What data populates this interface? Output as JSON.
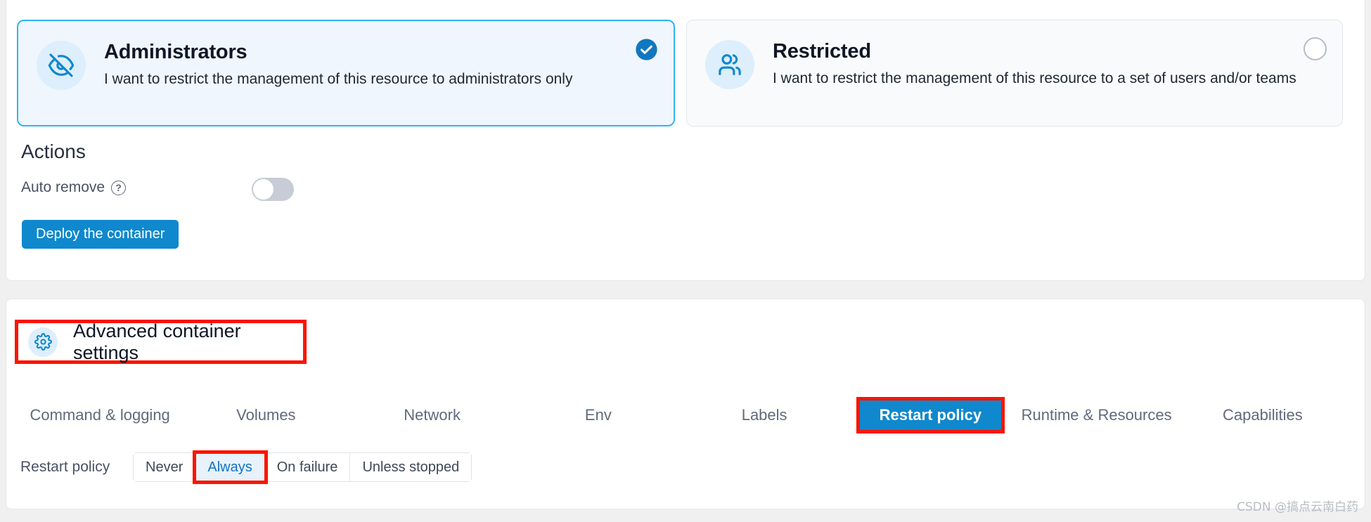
{
  "access_control": {
    "cards": [
      {
        "id": "administrators",
        "icon": "eye-off-icon",
        "title": "Administrators",
        "description": "I want to restrict the management of this resource to administrators only",
        "selected": true,
        "indicator": "check-circle-filled-icon"
      },
      {
        "id": "restricted",
        "icon": "users-icon",
        "title": "Restricted",
        "description": "I want to restrict the management of this resource to a set of users and/or teams",
        "selected": false,
        "indicator": "radio-empty-icon"
      }
    ]
  },
  "actions": {
    "title": "Actions",
    "auto_remove_label": "Auto remove",
    "auto_remove_help_icon": "question-mark-icon",
    "auto_remove_value": "off",
    "deploy_button": "Deploy the container"
  },
  "advanced": {
    "icon": "gear-icon",
    "title": "Advanced container settings",
    "tabs": [
      {
        "label": "Command & logging",
        "active": false
      },
      {
        "label": "Volumes",
        "active": false
      },
      {
        "label": "Network",
        "active": false
      },
      {
        "label": "Env",
        "active": false
      },
      {
        "label": "Labels",
        "active": false
      },
      {
        "label": "Restart policy",
        "active": true
      },
      {
        "label": "Runtime & Resources",
        "active": false
      },
      {
        "label": "Capabilities",
        "active": false
      }
    ],
    "restart_policy": {
      "label": "Restart policy",
      "options": [
        {
          "label": "Never",
          "selected": false
        },
        {
          "label": "Always",
          "selected": true
        },
        {
          "label": "On failure",
          "selected": false
        },
        {
          "label": "Unless stopped",
          "selected": false
        }
      ]
    }
  },
  "watermark": "CSDN @搞点云南白药",
  "colors": {
    "accent_blue": "#0f88cd",
    "selected_border": "#2db6f0",
    "selected_fill": "#eff6fd",
    "highlight_red": "#fc1403",
    "icon_circle": "#ddeefc",
    "page_bg": "#f0f0f1"
  }
}
